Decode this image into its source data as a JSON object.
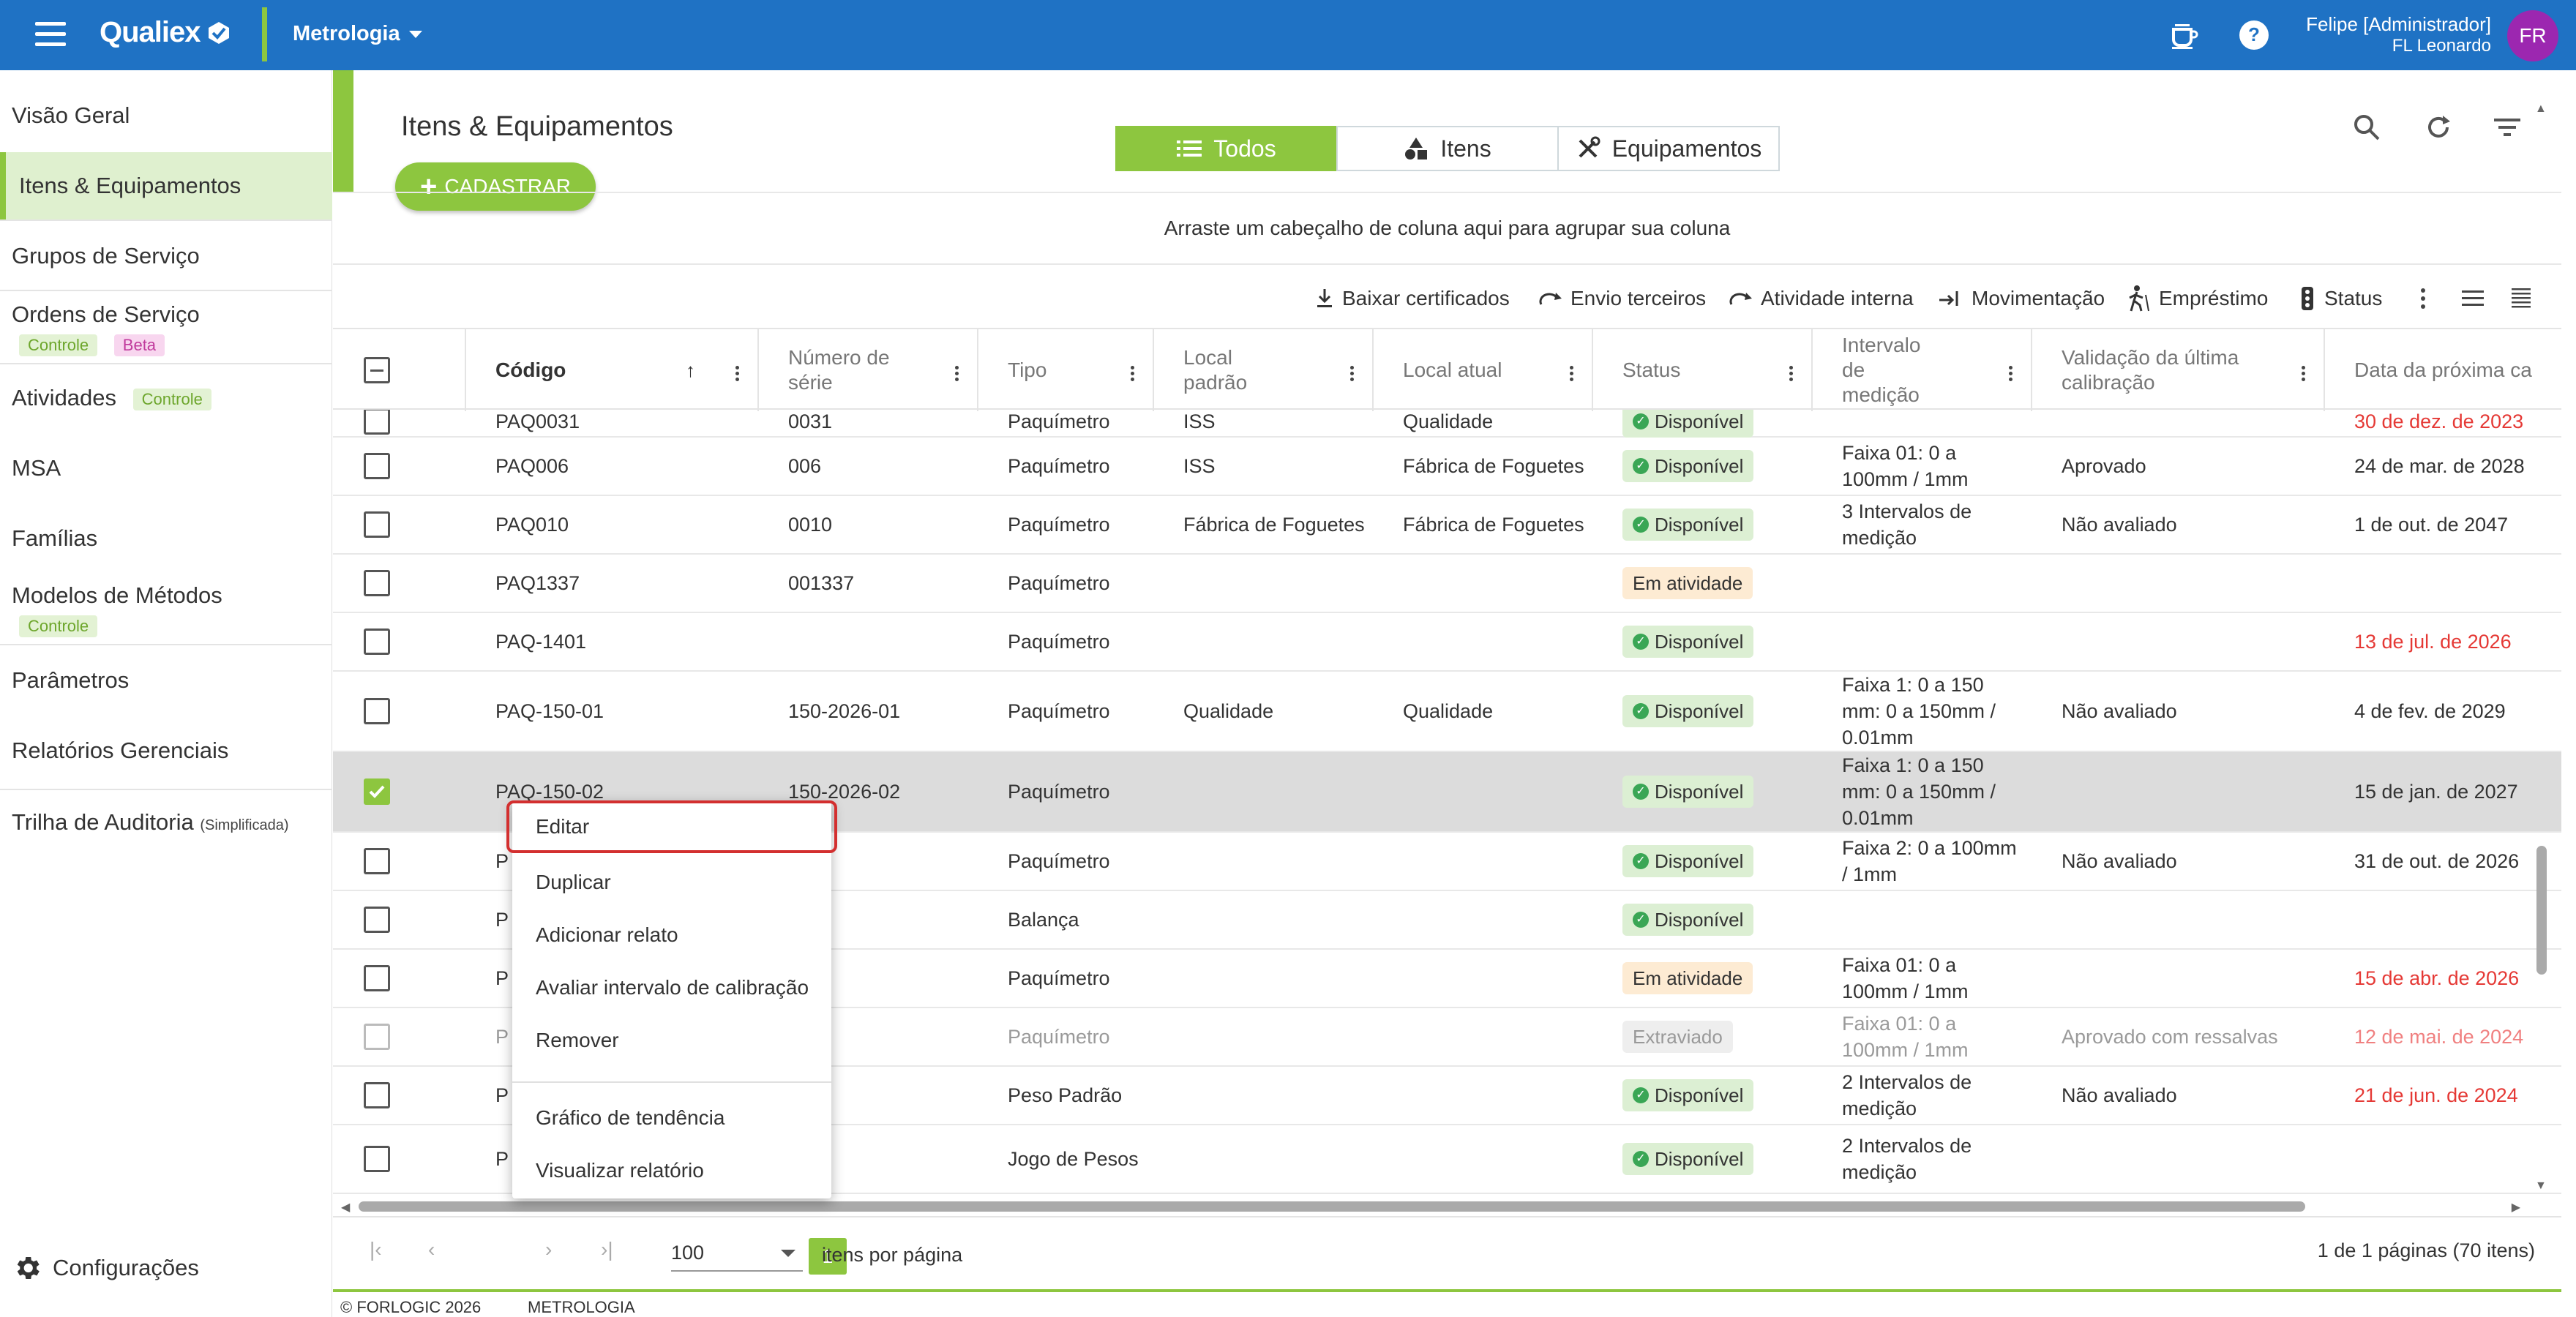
{
  "header": {
    "logo": "Qualiex",
    "module": "Metrologia",
    "user_name": "Felipe [Administrador]",
    "user_sub": "FL Leonardo",
    "avatar": "FR",
    "icons": [
      "hamburger-icon",
      "coffee-icon",
      "help-icon"
    ]
  },
  "sidebar": {
    "items": [
      {
        "label": "Visão Geral"
      },
      {
        "label": "Itens & Equipamentos",
        "active": true
      },
      {
        "label": "Grupos de Serviço"
      },
      {
        "label": "Ordens de Serviço",
        "tags": [
          "Controle",
          "Beta"
        ]
      },
      {
        "label": "Atividades",
        "tags": [
          "Controle"
        ]
      },
      {
        "label": "MSA"
      },
      {
        "label": "Famílias"
      },
      {
        "label": "Modelos de Métodos",
        "tags": [
          "Controle"
        ]
      },
      {
        "label": "Parâmetros"
      },
      {
        "label": "Relatórios Gerenciais"
      },
      {
        "label": "Trilha de Auditoria",
        "small": "(Simplificada)"
      }
    ],
    "settings": "Configurações"
  },
  "page": {
    "title": "Itens & Equipamentos",
    "add_button": "CADASTRAR",
    "tabs": [
      {
        "label": "Todos",
        "icon": "list-icon",
        "active": true
      },
      {
        "label": "Itens",
        "icon": "shapes-icon"
      },
      {
        "label": "Equipamentos",
        "icon": "tools-icon"
      }
    ],
    "group_hint": "Arraste um cabeçalho de coluna aqui para agrupar sua coluna",
    "toolbar": {
      "download": "Baixar certificados",
      "third": "Envio terceiros",
      "internal": "Atividade interna",
      "move": "Movimentação",
      "loan": "Empréstimo",
      "status": "Status"
    }
  },
  "grid": {
    "columns": {
      "code": "Código",
      "serial": "Número de série",
      "type": "Tipo",
      "local_default": "Local padrão",
      "local_current": "Local atual",
      "status": "Status",
      "interval": "Intervalo de medição",
      "validation": "Validação da última calibração",
      "next_date": "Data da próxima ca"
    },
    "rows": [
      {
        "code": "PAQ0031",
        "serial": "0031",
        "type": "Paquímetro",
        "ld": "ISS",
        "lc": "Qualidade",
        "status": "Disponível",
        "interval": "",
        "validation": "",
        "date": "30 de dez. de 2023"
      },
      {
        "code": "PAQ006",
        "serial": "006",
        "type": "Paquímetro",
        "ld": "ISS",
        "lc": "Fábrica de Foguetes",
        "status": "Disponível",
        "interval": "Faixa 01: 0 a 100mm / 1mm",
        "validation": "Aprovado",
        "date": "24 de mar. de 2028"
      },
      {
        "code": "PAQ010",
        "serial": "0010",
        "type": "Paquímetro",
        "ld": "Fábrica de Foguetes",
        "lc": "Fábrica de Foguetes",
        "status": "Disponível",
        "interval": "3 Intervalos de medição",
        "validation": "Não avaliado",
        "date": "1 de out. de 2047"
      },
      {
        "code": "PAQ1337",
        "serial": "001337",
        "type": "Paquímetro",
        "ld": "",
        "lc": "",
        "status": "Em atividade",
        "interval": "",
        "validation": "",
        "date": ""
      },
      {
        "code": "PAQ-1401",
        "serial": "",
        "type": "Paquímetro",
        "ld": "",
        "lc": "",
        "status": "Disponível",
        "interval": "",
        "validation": "",
        "date": "13 de jul. de 2026"
      },
      {
        "code": "PAQ-150-01",
        "serial": "150-2026-01",
        "type": "Paquímetro",
        "ld": "Qualidade",
        "lc": "Qualidade",
        "status": "Disponível",
        "interval": "Faixa 1: 0 a 150 mm: 0 a 150mm / 0.01mm",
        "validation": "Não avaliado",
        "date": "4 de fev. de 2029"
      },
      {
        "code": "PAQ-150-02",
        "serial": "150-2026-02",
        "type": "Paquímetro",
        "ld": "",
        "lc": "",
        "status": "Disponível",
        "interval": "Faixa 1: 0 a 150 mm: 0 a 150mm / 0.01mm",
        "validation": "",
        "date": "15 de jan. de 2027"
      },
      {
        "code": "P",
        "serial": "",
        "type": "Paquímetro",
        "ld": "",
        "lc": "",
        "status": "Disponível",
        "interval": "Faixa 2: 0 a 100mm / 1mm",
        "validation": "Não avaliado",
        "date": "31 de out. de 2026"
      },
      {
        "code": "P",
        "serial": "",
        "type": "Balança",
        "ld": "",
        "lc": "",
        "status": "Disponível",
        "interval": "",
        "validation": "",
        "date": ""
      },
      {
        "code": "P",
        "serial": "",
        "type": "Paquímetro",
        "ld": "",
        "lc": "",
        "status": "Em atividade",
        "interval": "Faixa 01: 0 a 100mm / 1mm",
        "validation": "",
        "date": "15 de abr. de 2026"
      },
      {
        "code": "P",
        "serial": "",
        "type": "Paquímetro",
        "ld": "",
        "lc": "",
        "status": "Extraviado",
        "interval": "Faixa 01: 0 a 100mm / 1mm",
        "validation": "Aprovado com ressalvas",
        "date": "12 de mai. de 2024"
      },
      {
        "code": "P",
        "serial": "",
        "type": "Peso Padrão",
        "ld": "",
        "lc": "",
        "status": "Disponível",
        "interval": "2 Intervalos de medição",
        "validation": "Não avaliado",
        "date": "21 de jun. de 2024"
      },
      {
        "code": "P",
        "serial": "",
        "type": "Jogo de Pesos",
        "ld": "",
        "lc": "",
        "status": "Disponível",
        "interval": "2 Intervalos de medição",
        "validation": "",
        "date": ""
      }
    ]
  },
  "context_menu": {
    "items": [
      "Editar",
      "Duplicar",
      "Adicionar relato",
      "Avaliar intervalo de calibração",
      "Remover",
      "Gráfico de tendência",
      "Visualizar relatório"
    ]
  },
  "pager": {
    "current": "1",
    "page_size": "100",
    "label": "itens por página",
    "info": "1 de 1 páginas (70 itens)"
  },
  "footer": {
    "copyright": "© FORLOGIC 2026",
    "module": "METROLOGIA"
  },
  "colors": {
    "brand_blue": "#1f72c4",
    "accent_green": "#8dc63f",
    "overdue_red": "#e53935",
    "avatar_purple": "#9c27b0"
  }
}
